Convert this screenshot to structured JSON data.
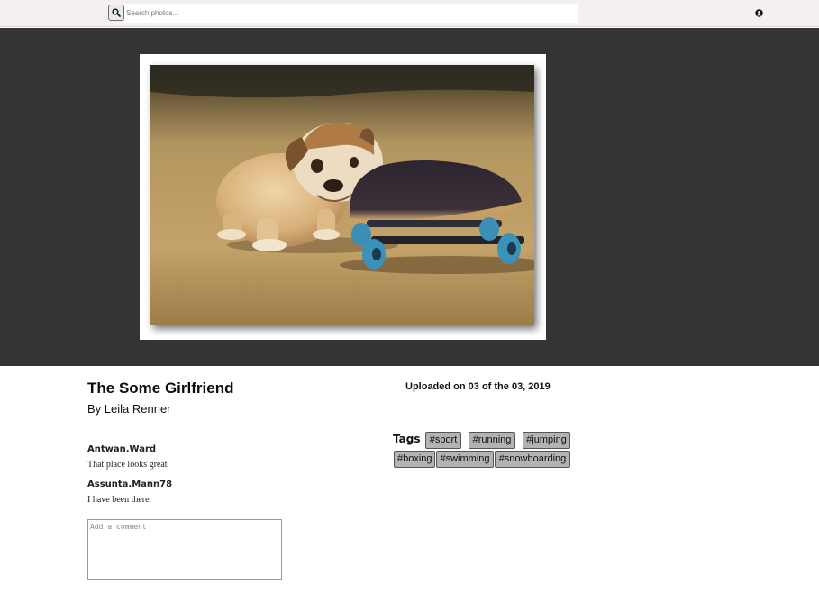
{
  "search": {
    "placeholder": "Search photos..."
  },
  "photo": {
    "title": "The Some Girlfriend",
    "author": "By Leila Renner",
    "uploaded": "Uploaded on 03 of the 03, 2019",
    "image_icon": "puppy-on-skateboard-photo"
  },
  "comments": [
    {
      "user": "Antwan.Ward",
      "text": "That place looks great"
    },
    {
      "user": "Assunta.Mann78",
      "text": "I have been there"
    }
  ],
  "comment_input": {
    "placeholder": "Add a comment"
  },
  "tags": {
    "label": "Tags",
    "items": [
      "#sport",
      "#running",
      "#jumping",
      "#boxing",
      "#swimming",
      "#snowboarding"
    ]
  },
  "icons": {
    "search": "search-icon",
    "user": "user-icon"
  },
  "colors": {
    "topbar": "#f5efef",
    "hero": "#353333",
    "tag": "#b4b2b2"
  }
}
